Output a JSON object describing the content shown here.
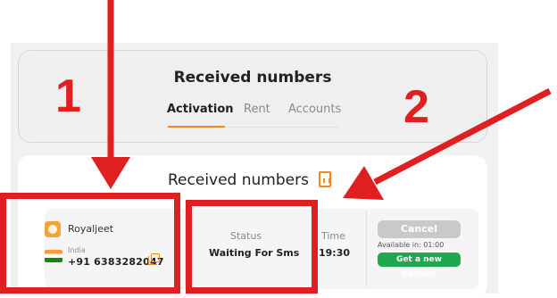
{
  "header": {
    "title": "Received numbers",
    "tabs": [
      {
        "label": "Activation",
        "active": true
      },
      {
        "label": "Rent",
        "active": false
      },
      {
        "label": "Accounts",
        "active": false
      }
    ]
  },
  "main": {
    "title": "Received numbers",
    "title_icon": "document-icon"
  },
  "order": {
    "service": "Royaljeet",
    "service_icon": "royaljeet-app-icon",
    "country": "India",
    "phone": "+91 6383282047",
    "status_label": "Status",
    "status_value": "Waiting For Sms",
    "time_label": "Time",
    "time_value": "19:30",
    "cancel_label": "Cancel",
    "available_in": "Available in: 01:00",
    "new_number_label": "Get a new number"
  },
  "annotations": {
    "label_1": "1",
    "label_2": "2",
    "color": "#e02020"
  },
  "colors": {
    "accent": "#f08a1c",
    "success": "#1fa84e",
    "disabled": "#c9c9c9"
  }
}
